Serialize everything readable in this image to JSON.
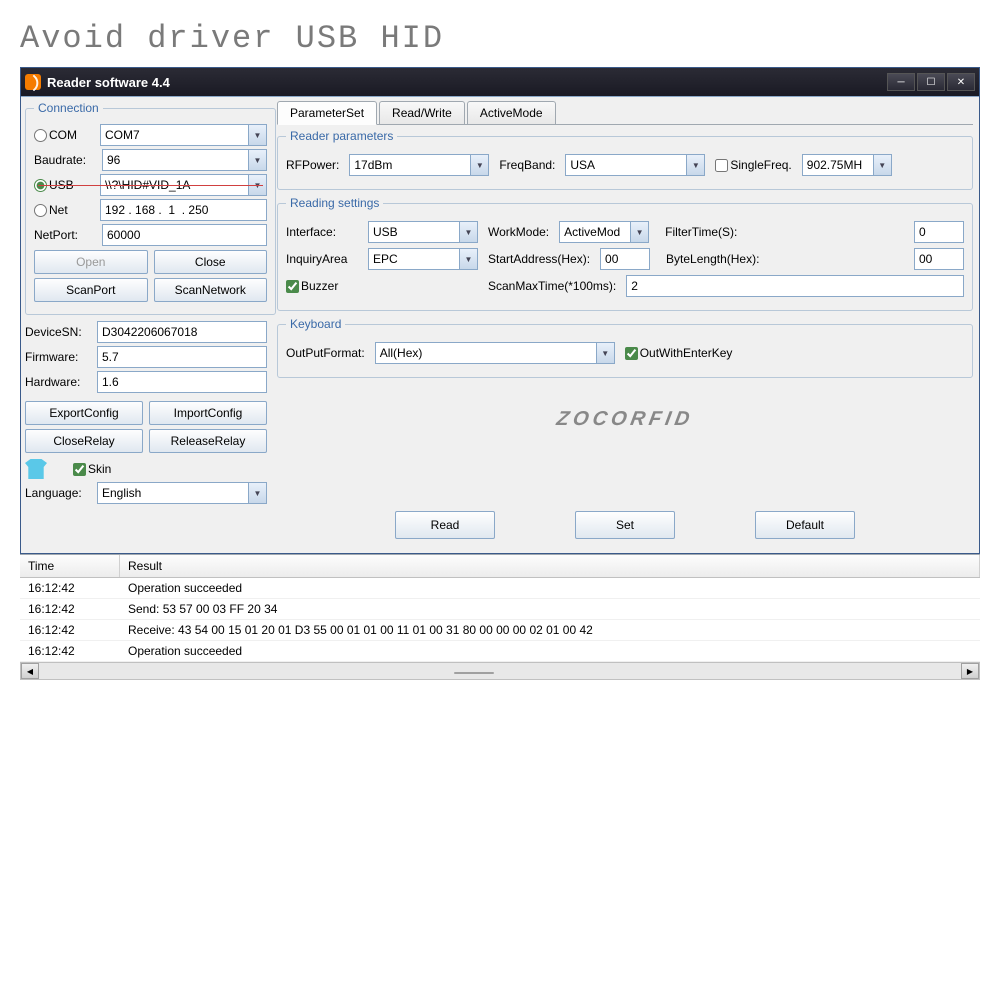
{
  "page_title": "Avoid driver USB HID",
  "window_title": "Reader software 4.4",
  "sidebar": {
    "group_connection": "Connection",
    "radio_com": "COM",
    "com_value": "COM7",
    "baudrate_label": "Baudrate:",
    "baudrate_value": "96",
    "radio_usb": "USB",
    "usb_value": "\\\\?\\HID#VID_1A",
    "radio_net": "Net",
    "net_value": "192 . 168 .  1  . 250",
    "netport_label": "NetPort:",
    "netport_value": "60000",
    "btn_open": "Open",
    "btn_close": "Close",
    "btn_scanport": "ScanPort",
    "btn_scannetwork": "ScanNetwork",
    "devicesn_label": "DeviceSN:",
    "devicesn_value": "D3042206067018",
    "firmware_label": "Firmware:",
    "firmware_value": "5.7",
    "hardware_label": "Hardware:",
    "hardware_value": "1.6",
    "btn_exportconfig": "ExportConfig",
    "btn_importconfig": "ImportConfig",
    "btn_closerelay": "CloseRelay",
    "btn_releaserelay": "ReleaseRelay",
    "chk_skin": "Skin",
    "language_label": "Language:",
    "language_value": "English"
  },
  "tabs": {
    "t1": "ParameterSet",
    "t2": "Read/Write",
    "t3": "ActiveMode"
  },
  "reader_params": {
    "legend": "Reader parameters",
    "rfpower_label": "RFPower:",
    "rfpower_value": "17dBm",
    "freqband_label": "FreqBand:",
    "freqband_value": "USA",
    "singlefreq_label": "SingleFreq.",
    "singlefreq_value": "902.75MH"
  },
  "reading_settings": {
    "legend": "Reading settings",
    "interface_label": "Interface:",
    "interface_value": "USB",
    "workmode_label": "WorkMode:",
    "workmode_value": "ActiveMod",
    "filtertime_label": "FilterTime(S):",
    "filtertime_value": "0",
    "inquiryarea_label": "InquiryArea",
    "inquiryarea_value": "EPC",
    "startaddr_label": "StartAddress(Hex):",
    "startaddr_value": "00",
    "bytelen_label": "ByteLength(Hex):",
    "bytelen_value": "00",
    "buzzer_label": "Buzzer",
    "scanmax_label": "ScanMaxTime(*100ms):",
    "scanmax_value": "2"
  },
  "keyboard": {
    "legend": "Keyboard",
    "output_label": "OutPutFormat:",
    "output_value": "All(Hex)",
    "outenter_label": "OutWithEnterKey"
  },
  "watermark": "ZOCORFID",
  "actions": {
    "read": "Read",
    "set": "Set",
    "default": "Default"
  },
  "log": {
    "col_time": "Time",
    "col_result": "Result",
    "rows": [
      {
        "time": "16:12:42",
        "result": "Operation succeeded"
      },
      {
        "time": "16:12:42",
        "result": "Send: 53 57 00 03 FF 20 34"
      },
      {
        "time": "16:12:42",
        "result": "Receive: 43 54 00 15 01 20 01 D3 55 00 01 01 00 11 01 00 31 80 00 00 00 02 01 00 42"
      },
      {
        "time": "16:12:42",
        "result": "Operation succeeded"
      }
    ]
  }
}
